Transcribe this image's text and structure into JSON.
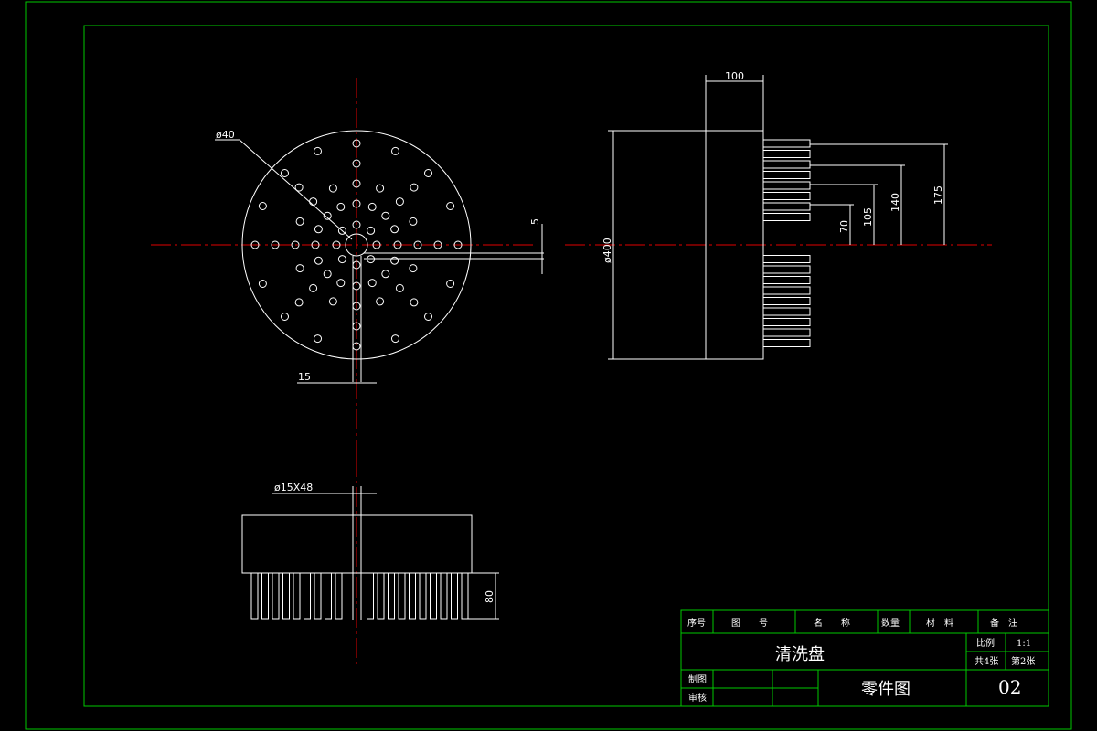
{
  "dimensions": {
    "hole_dia": "ø40",
    "gap_5": "5",
    "offset_15": "15",
    "width_100": "100",
    "dia_400": "ø400",
    "r175": "175",
    "r140": "140",
    "r105": "105",
    "r70": "70",
    "shaft": "ø15X48",
    "bristle_80": "80"
  },
  "title_block": {
    "headers": [
      "序号",
      "图　　号",
      "名　　称",
      "数量",
      "材　料",
      "备　注"
    ],
    "part_name": "清洗盘",
    "scale_label": "比例",
    "scale_value": "1:1",
    "sheet_total": "共4张",
    "sheet_no": "第2张",
    "drawn_label": "制图",
    "checked_label": "审核",
    "drawing_type": "零件图",
    "drawing_no": "02"
  },
  "colors": {
    "border": "#00c800",
    "lines": "#ffffff",
    "centerline": "#e00000",
    "background": "#000000"
  }
}
